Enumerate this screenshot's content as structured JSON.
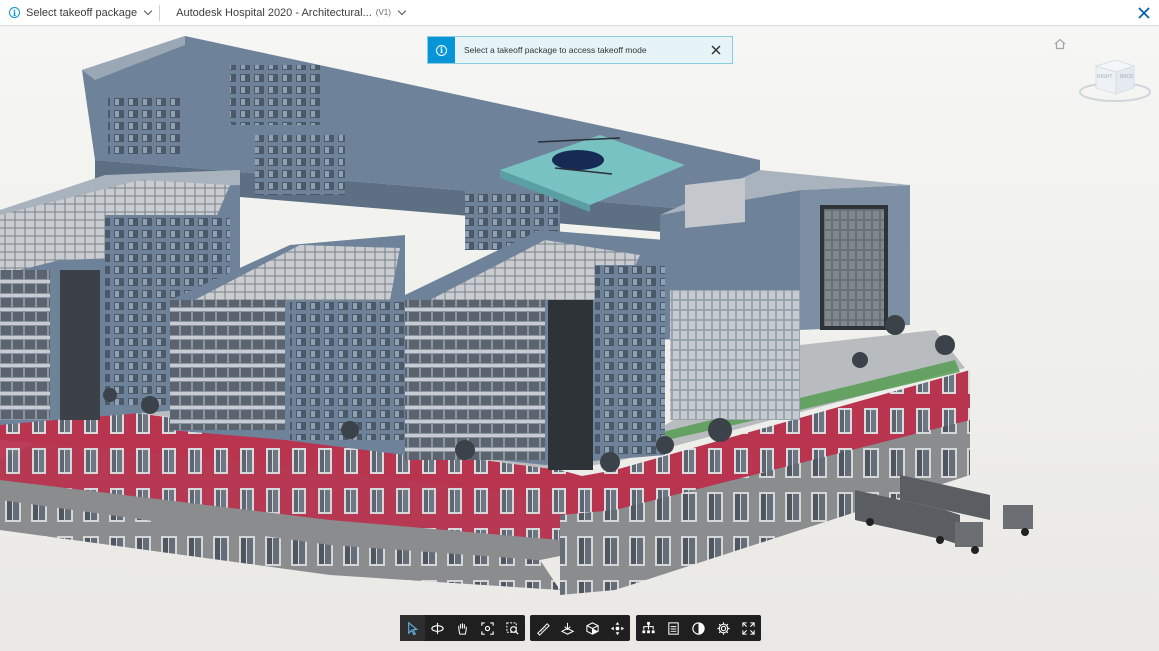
{
  "topbar": {
    "package_label": "Select takeoff package",
    "model_name": "Autodesk Hospital 2020 - Architectural...",
    "version": "(V1)"
  },
  "toast": {
    "message": "Select a takeoff package to access takeoff mode"
  },
  "viewcube": {
    "face_labels": [
      "RIGHT",
      "BACK"
    ]
  },
  "toolbar": {
    "groups": [
      [
        "select-icon",
        "orbit-icon",
        "pan-icon",
        "fit-to-view-icon",
        "zoom-window-icon"
      ],
      [
        "measure-icon",
        "section-icon",
        "explode-icon",
        "first-person-icon"
      ],
      [
        "model-browser-icon",
        "properties-icon",
        "render-settings-icon",
        "settings-icon",
        "fullscreen-icon"
      ]
    ]
  },
  "colors": {
    "accent": "#0696d7",
    "toolbar_bg": "#1f1f1f",
    "facade_blue": "#6e8299",
    "brick_red": "#b8344f",
    "concrete": "#8a8c8e"
  }
}
